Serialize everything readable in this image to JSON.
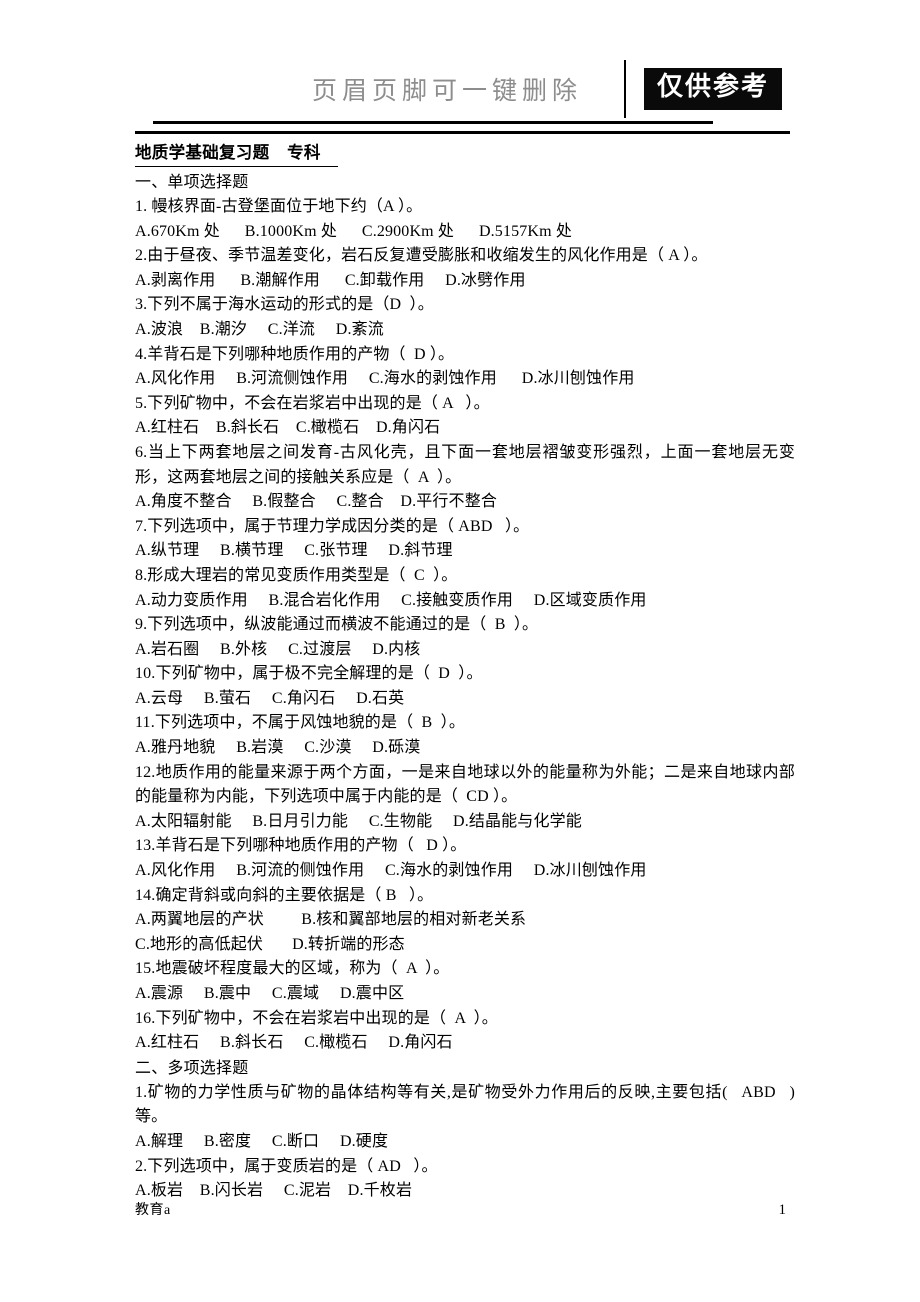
{
  "header": {
    "watermark_text": "页眉页脚可一键删除",
    "badge_text": "仅供参考"
  },
  "document": {
    "title": "地质学基础复习题    专科    ",
    "sections": [
      {
        "heading": "一、单项选择题",
        "questions": [
          {
            "stem": "1. 幔核界面-古登堡面位于地下约（A ）。",
            "options": "A.670Km 处      B.1000Km 处      C.2900Km 处      D.5157Km 处"
          },
          {
            "stem": "2.由于昼夜、季节温差变化，岩石反复遭受膨胀和收缩发生的风化作用是（ A ）。",
            "options": "A.剥离作用      B.潮解作用      C.卸载作用     D.冰劈作用"
          },
          {
            "stem": "3.下列不属于海水运动的形式的是（D  ）。",
            "options": "A.波浪    B.潮汐     C.洋流     D.紊流"
          },
          {
            "stem": "4.羊背石是下列哪种地质作用的产物（  D ）。",
            "options": "A.风化作用     B.河流侧蚀作用     C.海水的剥蚀作用      D.冰川刨蚀作用"
          },
          {
            "stem": "5.下列矿物中，不会在岩浆岩中出现的是（ A   ）。",
            "options": "A.红柱石    B.斜长石    C.橄榄石    D.角闪石"
          },
          {
            "stem": "6.当上下两套地层之间发育-古风化壳，且下面一套地层褶皱变形强烈，上面一套地层无变形，这两套地层之间的接触关系应是（  A  ）。",
            "options": "A.角度不整合     B.假整合     C.整合    D.平行不整合"
          },
          {
            "stem": "7.下列选项中，属于节理力学成因分类的是（ ABD   ）。",
            "options": "A.纵节理     B.横节理     C.张节理     D.斜节理"
          },
          {
            "stem": "8.形成大理岩的常见变质作用类型是（  C  ）。",
            "options": "A.动力变质作用     B.混合岩化作用     C.接触变质作用     D.区域变质作用"
          },
          {
            "stem": "9.下列选项中，纵波能通过而横波不能通过的是（  B  ）。",
            "options": "A.岩石圈     B.外核     C.过渡层     D.内核"
          },
          {
            "stem": "10.下列矿物中，属于极不完全解理的是（  D  ）。",
            "options": "A.云母     B.萤石     C.角闪石     D.石英"
          },
          {
            "stem": "11.下列选项中，不属于风蚀地貌的是（  B  ）。",
            "options": "A.雅丹地貌     B.岩漠     C.沙漠     D.砾漠"
          },
          {
            "stem": "12.地质作用的能量来源于两个方面，一是来自地球以外的能量称为外能；二是来自地球内部的能量称为内能，下列选项中属于内能的是（  CD ）。",
            "options": "A.太阳辐射能     B.日月引力能     C.生物能     D.结晶能与化学能"
          },
          {
            "stem": "13.羊背石是下列哪种地质作用的产物（   D ）。",
            "options": "A.风化作用     B.河流的侧蚀作用     C.海水的剥蚀作用     D.冰川刨蚀作用"
          },
          {
            "stem": "14.确定背斜或向斜的主要依据是（ B   ）。",
            "options": "A.两翼地层的产状         B.核和翼部地层的相对新老关系\nC.地形的高低起伏       D.转折端的形态"
          },
          {
            "stem": "15.地震破坏程度最大的区域，称为（  A  ）。",
            "options": "A.震源     B.震中     C.震域     D.震中区"
          },
          {
            "stem": "16.下列矿物中，不会在岩浆岩中出现的是（  A  ）。",
            "options": "A.红柱石     B.斜长石     C.橄榄石     D.角闪石"
          }
        ]
      },
      {
        "heading": "二、多项选择题",
        "questions": [
          {
            "stem": "1.矿物的力学性质与矿物的晶体结构等有关,是矿物受外力作用后的反映,主要包括(   ABD   )等。",
            "options": "A.解理     B.密度     C.断口     D.硬度"
          },
          {
            "stem": "2.下列选项中，属于变质岩的是（ AD   ）。",
            "options": "A.板岩    B.闪长岩     C.泥岩    D.千枚岩"
          }
        ]
      }
    ]
  },
  "footer": {
    "left_text": "教育a",
    "page_number": "1"
  }
}
